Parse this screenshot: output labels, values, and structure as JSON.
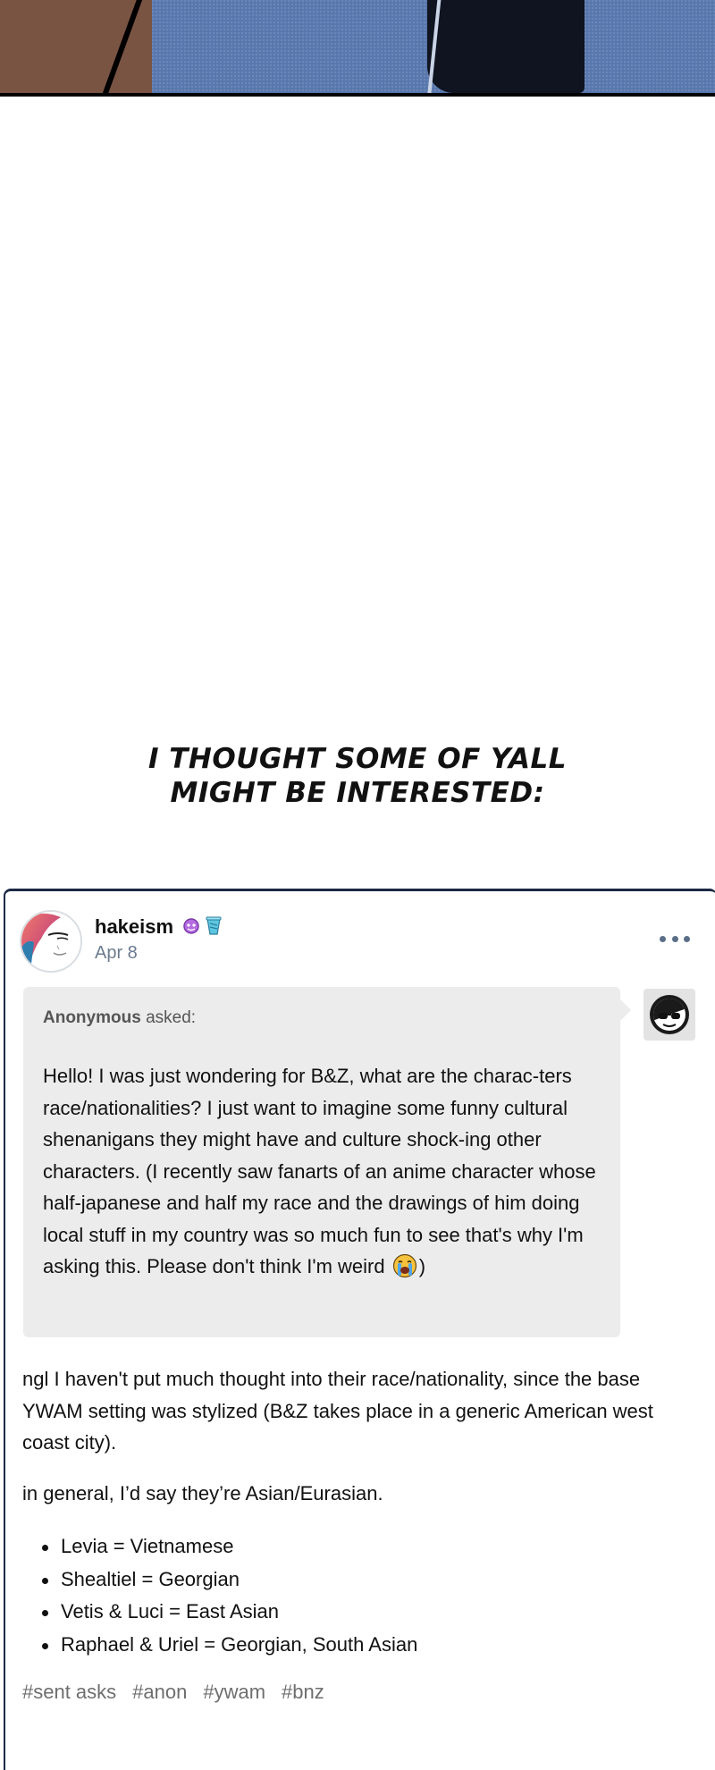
{
  "caption": {
    "line1": "I thought some of yall",
    "line2": "might be interested:"
  },
  "post": {
    "username": "hakeism",
    "date": "Apr 8",
    "more_icon": "ellipsis-icon",
    "ask": {
      "asker_name": "Anonymous",
      "asker_suffix": "asked:",
      "text_main": "Hello! I was just wondering for B&Z, what are the charac-ters race/nationalities? I just want to imagine some funny cultural shenanigans they might have and culture shock-ing other characters. (I recently saw fanarts of an anime character whose half-japanese and half my race and the drawings of him doing local stuff in my country was so much fun to see that's why I'm asking this. Please don't think I'm weird",
      "text_emoji": "crying-face-emoji",
      "text_end": ")"
    },
    "answer": {
      "paragraph1": "ngl I haven't put much thought into their race/nationality, since the base YWAM setting was stylized (B&Z takes place in a generic American west coast city).",
      "paragraph2": "in general, I’d say they’re Asian/Eurasian.",
      "list": [
        "Levia = Vietnamese",
        "Shealtiel = Georgian",
        "Vetis & Luci = East Asian",
        "Raphael & Uriel = Georgian, South Asian"
      ]
    },
    "tags": [
      "#sent asks",
      "#anon",
      "#ywam",
      "#bnz"
    ]
  },
  "colors": {
    "ask_background": "#ececec",
    "date_text": "#6b7b8f",
    "tag_text": "#6e6e6e",
    "card_border": "#1b2a44"
  }
}
